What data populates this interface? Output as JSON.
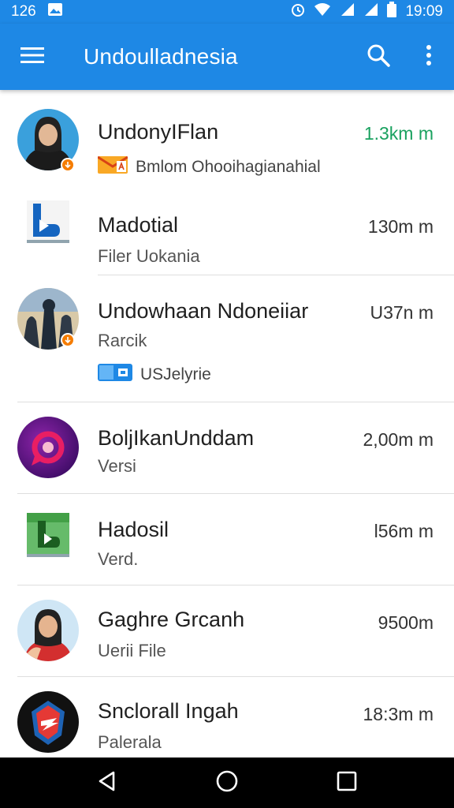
{
  "status_bar": {
    "left_text": "126",
    "time": "19:09",
    "icons": [
      "image-icon",
      "alarm-icon",
      "wifi-icon",
      "signal-icon",
      "signal-icon",
      "battery-icon"
    ]
  },
  "app_bar": {
    "title": "Undoulladnesia",
    "icons": [
      "menu-icon",
      "search-icon",
      "more-vert-icon"
    ]
  },
  "colors": {
    "primary": "#1e88e5",
    "accent_time": "#19a15f",
    "badge": "#f57c00",
    "nav_bar": "#000000"
  },
  "items": [
    {
      "title": "UndonyIFlan",
      "subtitle": "",
      "meta": "Bmlom Ohooihagianahial",
      "meta_icon": "mail-icon",
      "time": "1.3km m"
    },
    {
      "title": "Madotial",
      "subtitle": "Filer Uokania",
      "meta": "",
      "meta_icon": "",
      "time": "130m m"
    },
    {
      "title": "Undowhaan Ndoneiiar",
      "subtitle": "Rarcik",
      "meta": "USJelyrie",
      "meta_icon": "folder-icon",
      "time": "U37n m"
    },
    {
      "title": "BoljIkanUnddam",
      "subtitle": "Versi",
      "meta": "",
      "meta_icon": "",
      "time": "2,00m m"
    },
    {
      "title": "Hadosil",
      "subtitle": "Verd.",
      "meta": "",
      "meta_icon": "",
      "time": "l56m m"
    },
    {
      "title": "Gaghre Grcanh",
      "subtitle": "Uerii File",
      "meta": "",
      "meta_icon": "",
      "time": "9500m"
    },
    {
      "title": "Snclorall Ingah",
      "subtitle": "Palerala",
      "meta": "",
      "meta_icon": "",
      "time": "18:3m m"
    }
  ],
  "nav_bar": {
    "icons": [
      "back-icon",
      "home-icon",
      "recents-icon"
    ]
  }
}
